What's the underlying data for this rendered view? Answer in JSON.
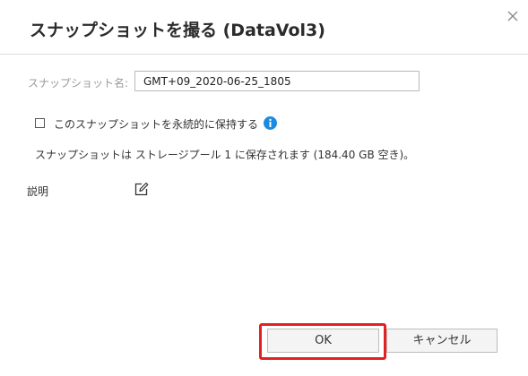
{
  "dialog": {
    "title": "スナップショットを撮る (DataVol3)"
  },
  "form": {
    "name_label": "スナップショット名:",
    "name_value": "GMT+09_2020-06-25_1805",
    "keep_forever_label": "このスナップショットを永続的に保持する",
    "keep_forever_checked": false,
    "storage_info": "スナップショットは ストレージプール 1 に保存されます (184.40 GB 空き)。",
    "description_label": "説明"
  },
  "buttons": {
    "ok": "OK",
    "cancel": "キャンセル"
  },
  "icons": {
    "close": "close-icon",
    "info": "info-icon",
    "edit": "edit-icon"
  },
  "colors": {
    "info_blue": "#1a8be0",
    "highlight_red": "#e42024"
  }
}
